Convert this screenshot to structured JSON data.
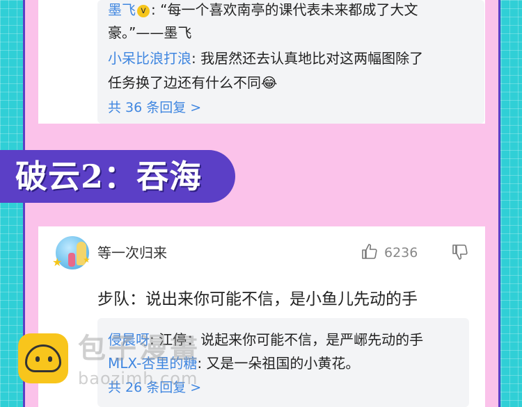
{
  "top_card": {
    "reply1_user": "墨飞",
    "reply1_badge": "v",
    "reply1_text_line1": ": “每一个喜欢南亭的课代表未来都成了大文",
    "reply1_text_line2": "豪。”——墨飞",
    "reply2_user": "小呆比浪打浪",
    "reply2_text_line1": ": 我居然还去认真地比对这两幅图除了",
    "reply2_text_line2": "任务换了边还有什么不同",
    "reply2_emoji": "😂",
    "more_replies": "共 36 条回复 >"
  },
  "banner": {
    "title": "破云2：吞海"
  },
  "comment": {
    "username": "等一次归来",
    "like_count": "6236",
    "text": "步队：说出来你可能不信，是小鱼儿先动的手",
    "replies": [
      {
        "user": "侵晨呀",
        "text": ": 江停：说起来你可能不信，是严峫先动的手"
      },
      {
        "user": "MLX-杏里的糖",
        "text": ": 又是一朵祖国的小黄花。"
      }
    ],
    "more_replies": "共 26 条回复 >"
  },
  "watermark": {
    "name": "包子漫畫",
    "url": "baozimh.com"
  },
  "colors": {
    "background": "#30cfd6",
    "panel": "#fbc2ea",
    "accent": "#5b3fc6",
    "username": "#3f86e0"
  }
}
